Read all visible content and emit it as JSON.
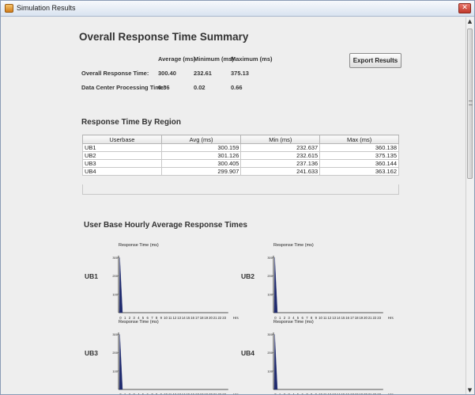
{
  "window": {
    "title": "Simulation Results",
    "close_glyph": "✕"
  },
  "summary": {
    "heading": "Overall Response Time Summary",
    "col_headers": [
      "Average (ms)",
      "Minimum (ms)",
      "Maximum (ms)"
    ],
    "rows": [
      {
        "label": "Overall Response Time:",
        "avg": "300.40",
        "min": "232.61",
        "max": "375.13"
      },
      {
        "label": "Data Center Processing Time:",
        "avg": "0.36",
        "min": "0.02",
        "max": "0.66"
      }
    ],
    "export_label": "Export Results"
  },
  "region": {
    "heading": "Response Time By Region",
    "columns": [
      "Userbase",
      "Avg (ms)",
      "Min (ms)",
      "Max (ms)"
    ],
    "rows": [
      [
        "UB1",
        "300.159",
        "232.637",
        "360.138"
      ],
      [
        "UB2",
        "301.126",
        "232.615",
        "375.135"
      ],
      [
        "UB3",
        "300.405",
        "237.136",
        "360.144"
      ],
      [
        "UB4",
        "299.907",
        "241.633",
        "363.162"
      ]
    ]
  },
  "hourly": {
    "heading": "User Base Hourly Average Response Times",
    "chart_data": [
      {
        "type": "bar",
        "label": "UB1",
        "title": "Response Time (ms)",
        "xlabel": "Hrs",
        "y_ticks": [
          "300",
          "200",
          "100"
        ],
        "ylim": [
          0,
          310
        ],
        "categories": [
          "0",
          "1",
          "2",
          "3",
          "4",
          "5",
          "6",
          "7",
          "8",
          "9",
          "10",
          "11",
          "12",
          "13",
          "14",
          "15",
          "16",
          "17",
          "18",
          "19",
          "20",
          "21",
          "22",
          "23"
        ],
        "values": [
          300,
          0,
          0,
          0,
          0,
          0,
          0,
          0,
          0,
          0,
          0,
          0,
          0,
          0,
          0,
          0,
          0,
          0,
          0,
          0,
          0,
          0,
          0,
          0
        ]
      },
      {
        "type": "bar",
        "label": "UB2",
        "title": "Response Time (ms)",
        "xlabel": "Hrs",
        "y_ticks": [
          "300",
          "200",
          "100"
        ],
        "ylim": [
          0,
          310
        ],
        "categories": [
          "0",
          "1",
          "2",
          "3",
          "4",
          "5",
          "6",
          "7",
          "8",
          "9",
          "10",
          "11",
          "12",
          "13",
          "14",
          "15",
          "16",
          "17",
          "18",
          "19",
          "20",
          "21",
          "22",
          "23"
        ],
        "values": [
          301,
          0,
          0,
          0,
          0,
          0,
          0,
          0,
          0,
          0,
          0,
          0,
          0,
          0,
          0,
          0,
          0,
          0,
          0,
          0,
          0,
          0,
          0,
          0
        ]
      },
      {
        "type": "bar",
        "label": "UB3",
        "title": "Response Time (ms)",
        "xlabel": "Hrs",
        "y_ticks": [
          "300",
          "200",
          "100"
        ],
        "ylim": [
          0,
          310
        ],
        "categories": [
          "0",
          "1",
          "2",
          "3",
          "4",
          "5",
          "6",
          "7",
          "8",
          "9",
          "10",
          "11",
          "12",
          "13",
          "14",
          "15",
          "16",
          "17",
          "18",
          "19",
          "20",
          "21",
          "22",
          "23"
        ],
        "values": [
          300,
          0,
          0,
          0,
          0,
          0,
          0,
          0,
          0,
          0,
          0,
          0,
          0,
          0,
          0,
          0,
          0,
          0,
          0,
          0,
          0,
          0,
          0,
          0
        ]
      },
      {
        "type": "bar",
        "label": "UB4",
        "title": "Response Time (ms)",
        "xlabel": "Hrs",
        "y_ticks": [
          "300",
          "200",
          "100"
        ],
        "ylim": [
          0,
          310
        ],
        "categories": [
          "0",
          "1",
          "2",
          "3",
          "4",
          "5",
          "6",
          "7",
          "8",
          "9",
          "10",
          "11",
          "12",
          "13",
          "14",
          "15",
          "16",
          "17",
          "18",
          "19",
          "20",
          "21",
          "22",
          "23"
        ],
        "values": [
          300,
          0,
          0,
          0,
          0,
          0,
          0,
          0,
          0,
          0,
          0,
          0,
          0,
          0,
          0,
          0,
          0,
          0,
          0,
          0,
          0,
          0,
          0,
          0
        ]
      }
    ]
  },
  "colors": {
    "bar": "#1f2a6e",
    "axis": "#222222"
  }
}
